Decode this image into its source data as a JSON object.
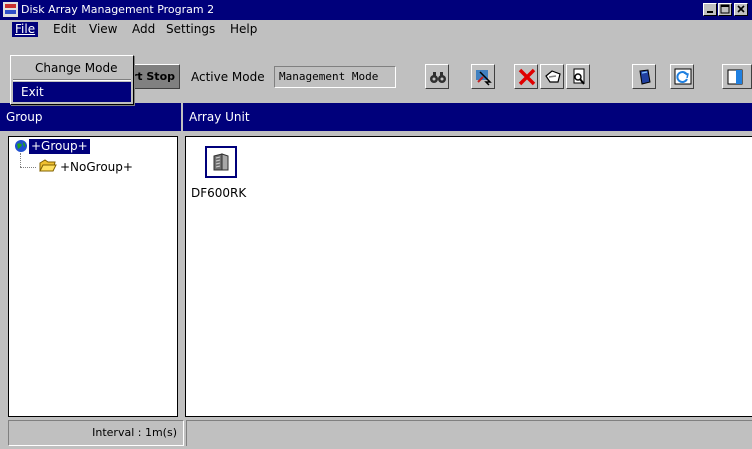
{
  "window": {
    "title": "Disk Array Management Program 2"
  },
  "menubar": {
    "items": [
      "File",
      "Edit",
      "View",
      "Add",
      "Settings",
      "Help"
    ]
  },
  "file_menu": {
    "items": [
      "Change Mode",
      "Exit"
    ]
  },
  "toolbar": {
    "start_stop_label": "rt Stop",
    "active_mode_label": "Active Mode",
    "active_mode_value": "Management Mode",
    "buttons": [
      "binoculars-icon",
      "arrow-tool-icon",
      "delete-icon",
      "tag-icon",
      "inspect-icon",
      "disk-icon",
      "refresh-icon",
      "window-icon"
    ]
  },
  "group_panel": {
    "header": "Group",
    "tree": {
      "root": "+Group+",
      "children": [
        "+NoGroup+"
      ]
    }
  },
  "array_panel": {
    "header": "Array Unit",
    "units": [
      {
        "name": "DF600RK"
      }
    ]
  },
  "statusbar": {
    "interval": "Interval : 1m(s)"
  },
  "colors": {
    "title_bar": "#00007b",
    "selection": "#00007b",
    "face": "#c0c0c0"
  }
}
